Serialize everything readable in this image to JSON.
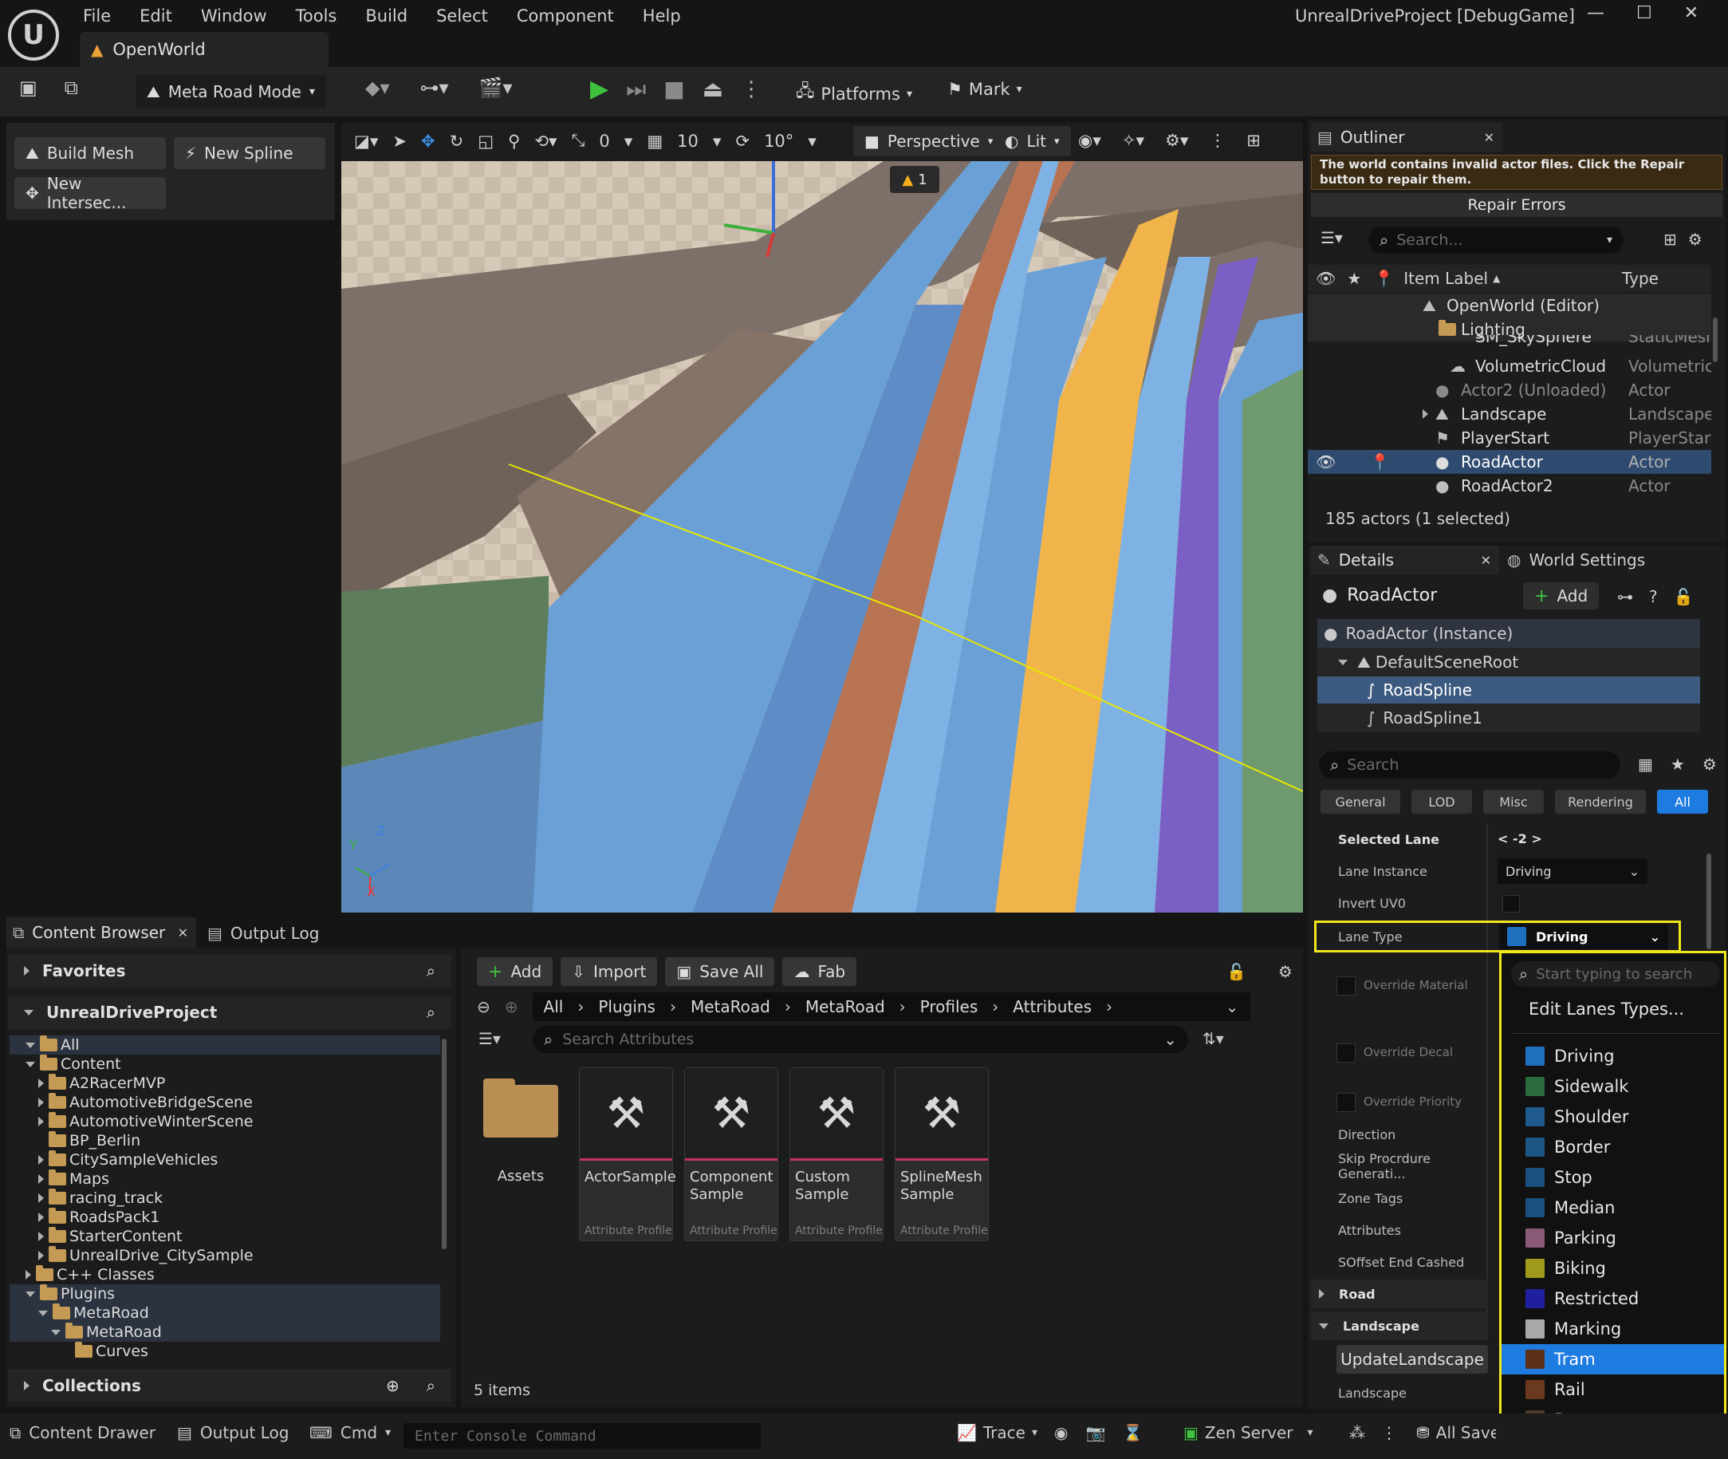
{
  "menu": {
    "items": [
      "File",
      "Edit",
      "Window",
      "Tools",
      "Build",
      "Select",
      "Component",
      "Help"
    ]
  },
  "window": {
    "title": "UnrealDriveProject [DebugGame]",
    "tab": "OpenWorld"
  },
  "toolbar": {
    "mode": "Meta Road Mode",
    "platforms": "Platforms",
    "mark": "Mark"
  },
  "road_mode": {
    "build_mesh": "Build Mesh",
    "new_spline": "New Spline",
    "new_intersection": "New Intersec..."
  },
  "viewport": {
    "perspective": "Perspective",
    "lit": "Lit",
    "snap_translate": "0",
    "snap_grid": "10",
    "snap_rotate": "10°",
    "warning_count": "1",
    "axis_x": "X",
    "axis_y": "Y",
    "axis_z": "Z"
  },
  "outliner": {
    "title": "Outliner",
    "warning": "The world contains invalid actor files. Click the Repair button to repair them.",
    "repair": "Repair Errors",
    "search_placeholder": "Search...",
    "col_label": "Item Label",
    "col_type": "Type",
    "rows": [
      {
        "label": "OpenWorld (Editor)",
        "type": ""
      },
      {
        "label": "Lighting",
        "type": ""
      },
      {
        "label": "SM_SkySphere",
        "type": "StaticMesh"
      },
      {
        "label": "VolumetricCloud",
        "type": "Volumetric("
      },
      {
        "label": "Actor2 (Unloaded)",
        "type": "Actor"
      },
      {
        "label": "Landscape",
        "type": "Landscape"
      },
      {
        "label": "PlayerStart",
        "type": "PlayerStart"
      },
      {
        "label": "RoadActor",
        "type": "Actor"
      },
      {
        "label": "RoadActor2",
        "type": "Actor"
      }
    ],
    "status": "185 actors (1 selected)"
  },
  "details": {
    "tab": "Details",
    "world_settings": "World Settings",
    "actor": "RoadActor",
    "add": "Add",
    "components": [
      "RoadActor (Instance)",
      "DefaultSceneRoot",
      "RoadSpline",
      "RoadSpline1"
    ],
    "search_placeholder": "Search",
    "filters": [
      "General",
      "LOD",
      "Misc",
      "Rendering",
      "All"
    ],
    "props": {
      "selected_lane": "Selected Lane",
      "selected_lane_val": "< -2 >",
      "lane_instance": "Lane Instance",
      "lane_instance_val": "Driving",
      "invert_uv": "Invert UV0",
      "lane_type": "Lane Type",
      "lane_type_val": "Driving",
      "override_material": "Override Material",
      "override_decal": "Override Decal",
      "override_priority": "Override Priority",
      "direction": "Direction",
      "skip": "Skip Procrdure Generati...",
      "zone_tags": "Zone Tags",
      "attributes": "Attributes",
      "soffset": "SOffset End Cashed",
      "road": "Road",
      "landscape_cat": "Landscape",
      "update_landscape": "UpdateLandscape",
      "landscape": "Landscape"
    }
  },
  "dropdown": {
    "search_placeholder": "Start typing to search",
    "edit": "Edit Lanes Types...",
    "items": [
      {
        "label": "Driving",
        "color": "#1f6fbf"
      },
      {
        "label": "Sidewalk",
        "color": "#2a6b3f"
      },
      {
        "label": "Shoulder",
        "color": "#1e5a8c"
      },
      {
        "label": "Border",
        "color": "#1d5585"
      },
      {
        "label": "Stop",
        "color": "#1a4f80"
      },
      {
        "label": "Median",
        "color": "#1a4f80"
      },
      {
        "label": "Parking",
        "color": "#8b5a7a"
      },
      {
        "label": "Biking",
        "color": "#a09a1c"
      },
      {
        "label": "Restricted",
        "color": "#1f1fa0"
      },
      {
        "label": "Marking",
        "color": "#a8a8a8"
      },
      {
        "label": "Tram",
        "color": "#5a3018"
      },
      {
        "label": "Rail",
        "color": "#6b3a1e"
      },
      {
        "label": "Bus",
        "color": "#4a3a2a"
      }
    ]
  },
  "content_browser": {
    "tab": "Content Browser",
    "output_log": "Output Log",
    "favorites": "Favorites",
    "project": "UnrealDriveProject",
    "collections": "Collections",
    "tree": [
      "All",
      "Content",
      "A2RacerMVP",
      "AutomotiveBridgeScene",
      "AutomotiveWinterScene",
      "BP_Berlin",
      "CitySampleVehicles",
      "Maps",
      "racing_track",
      "RoadsPack1",
      "StarterContent",
      "UnrealDrive_CitySample",
      "C++ Classes",
      "Plugins",
      "MetaRoad",
      "MetaRoad",
      "Curves"
    ],
    "add": "Add",
    "import": "Import",
    "save_all": "Save All",
    "fab": "Fab",
    "breadcrumb": [
      "All",
      "Plugins",
      "MetaRoad",
      "MetaRoad",
      "Profiles",
      "Attributes"
    ],
    "search_placeholder": "Search Attributes",
    "assets": [
      {
        "name": "Assets",
        "type": ""
      },
      {
        "name": "ActorSample",
        "type": "Attribute Profile"
      },
      {
        "name": "Component Sample",
        "type": "Attribute Profile"
      },
      {
        "name": "Custom Sample",
        "type": "Attribute Profile"
      },
      {
        "name": "SplineMesh Sample",
        "type": "Attribute Profile"
      }
    ],
    "count": "5 items"
  },
  "statusbar": {
    "content_drawer": "Content Drawer",
    "output_log": "Output Log",
    "cmd": "Cmd",
    "console_placeholder": "Enter Console Command",
    "trace": "Trace",
    "zen": "Zen Server",
    "save": "All Saved"
  }
}
